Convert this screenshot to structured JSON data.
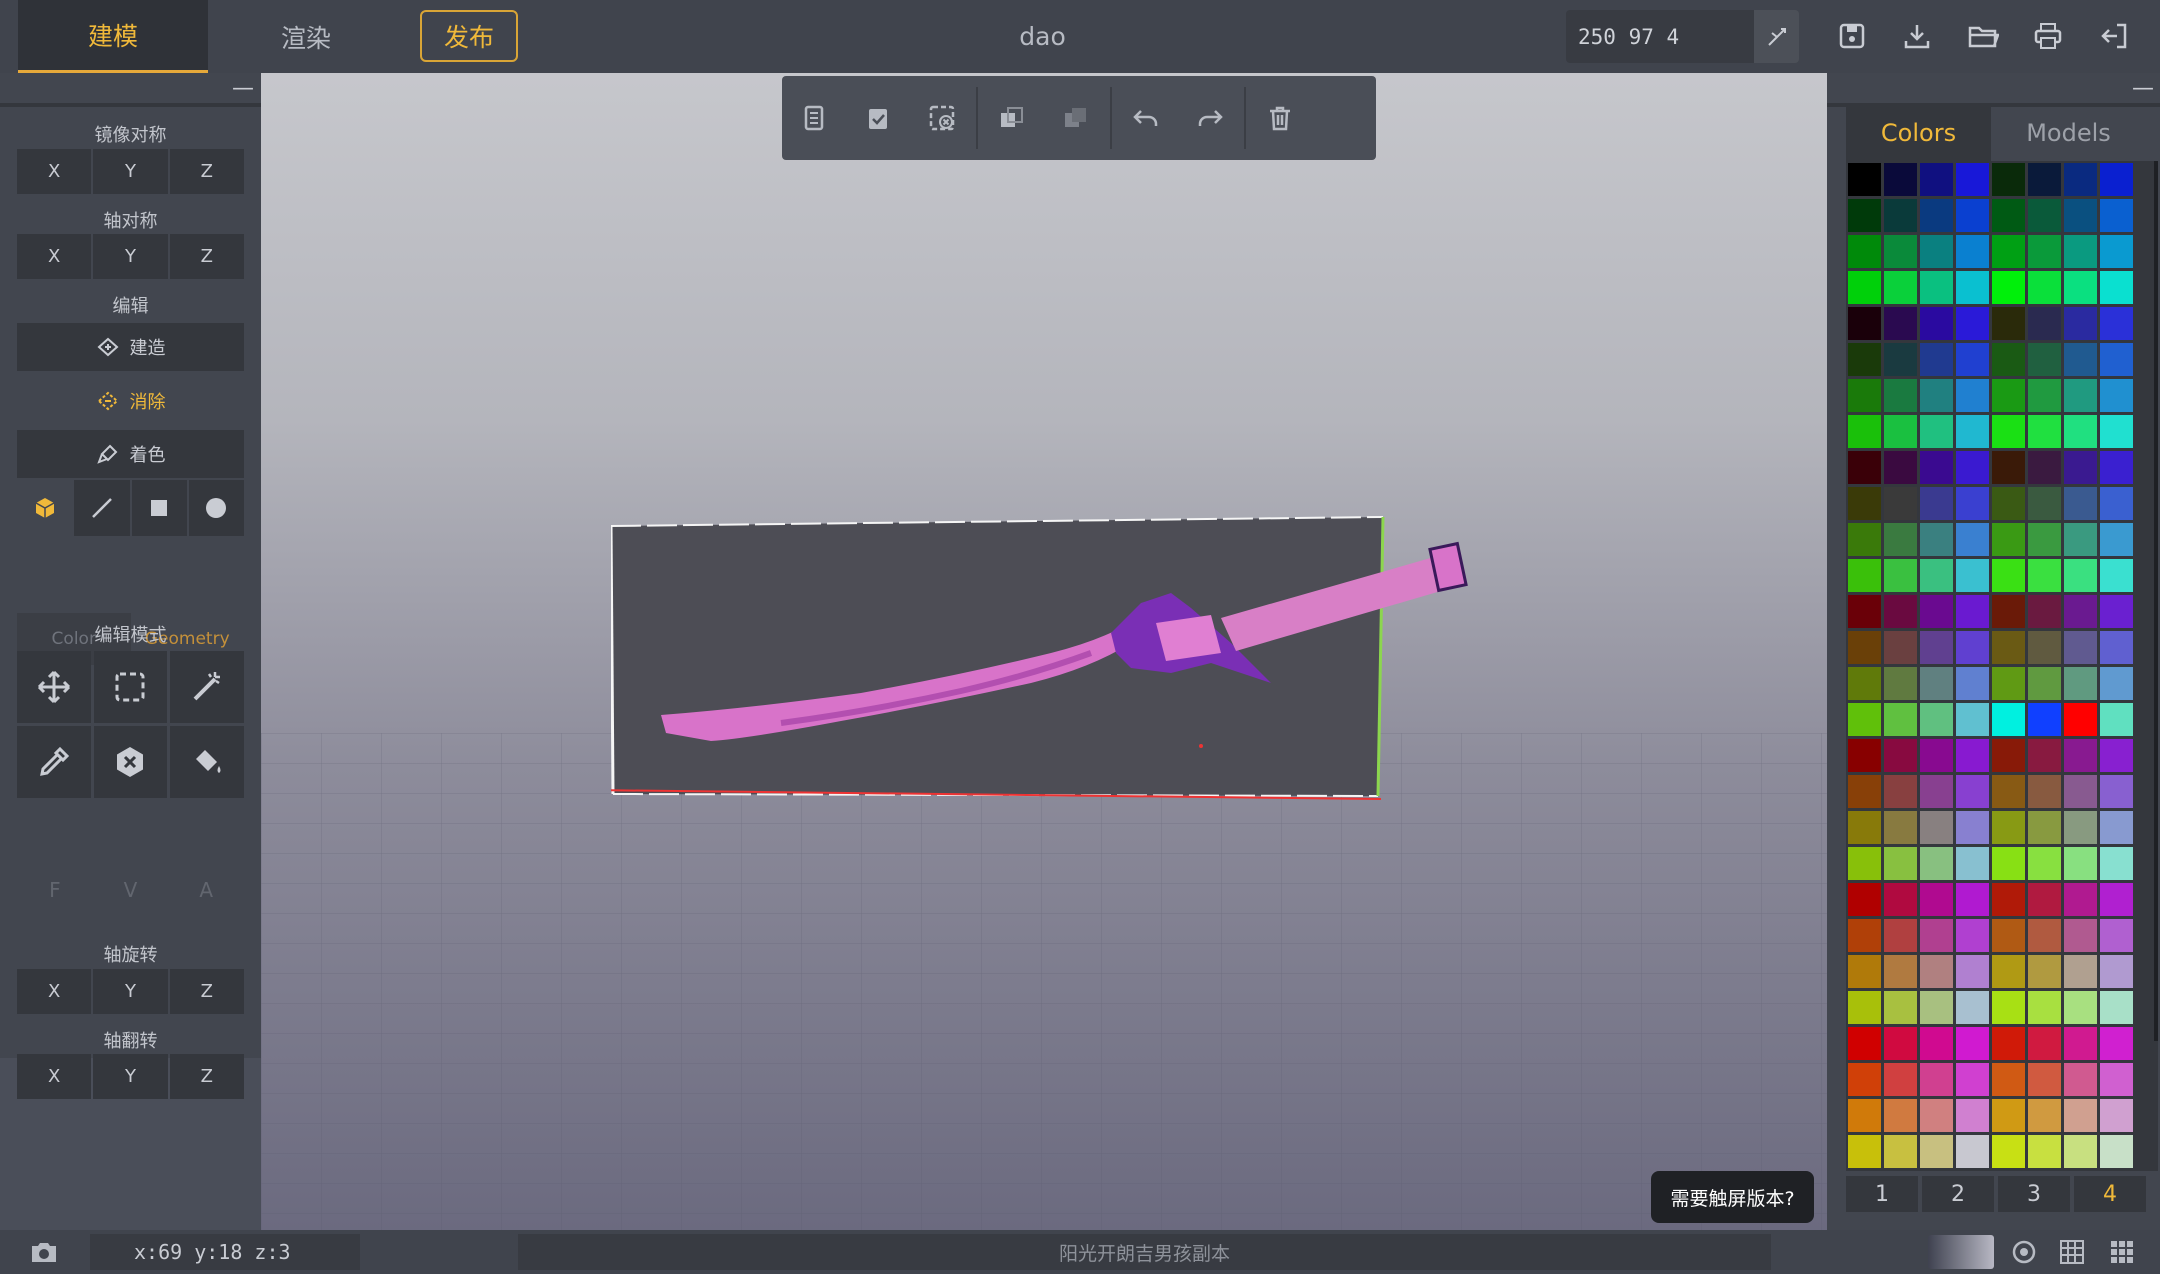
{
  "header": {
    "tabs": {
      "model": "建模",
      "render": "渲染",
      "publish": "发布"
    },
    "doc_title": "dao",
    "dimensions": "250 97 4",
    "icons": [
      "resize-icon",
      "save-icon",
      "download-icon",
      "open-folder-icon",
      "print-icon",
      "exit-icon"
    ]
  },
  "left_panel": {
    "collapse": "—",
    "mirror_label": "镜像对称",
    "axis_symmetry_label": "轴对称",
    "edit_label": "编辑",
    "build_label": "建造",
    "erase_label": "消除",
    "paint_label": "着色",
    "color_tab": "Color",
    "geometry_tab": "Geometry",
    "edit_mode_label": "编辑模式",
    "fva": [
      "F",
      "V",
      "A"
    ],
    "axis_rotate_label": "轴旋转",
    "axis_flip_label": "轴翻转",
    "axes": [
      "X",
      "Y",
      "Z"
    ]
  },
  "right_panel": {
    "collapse": "—",
    "tab_colors": "Colors",
    "tab_models": "Models",
    "pages": [
      "1",
      "2",
      "3",
      "4"
    ],
    "active_page": "4",
    "palette": [
      [
        "#000000",
        "#0a0a3a",
        "#101080",
        "#1818d8",
        "#0a2a0a",
        "#0a1a3a",
        "#0a2a80",
        "#0a20d0"
      ],
      [
        "#003a0a",
        "#0a3a3a",
        "#0a3a80",
        "#0a40d0",
        "#005a14",
        "#0a5a3a",
        "#0a5080",
        "#0a60d0"
      ],
      [
        "#008a0a",
        "#0a8a3a",
        "#0a8080",
        "#0a80d0",
        "#00a014",
        "#0a9a3a",
        "#0a9a80",
        "#0a9ad0"
      ],
      [
        "#00d00a",
        "#0ad03a",
        "#0ac080",
        "#0ac0d0",
        "#00f00a",
        "#0ae03a",
        "#0ae080",
        "#0ae0d0"
      ],
      [
        "#1a000a",
        "#2a0a50",
        "#2a0aa0",
        "#2a1ad8",
        "#2a2a0a",
        "#2a2a50",
        "#2a2aa0",
        "#2a30d8"
      ],
      [
        "#1a3a0a",
        "#1a3a40",
        "#203a90",
        "#2040d0",
        "#1a5a14",
        "#206040",
        "#205a90",
        "#2060d0"
      ],
      [
        "#1a7a0a",
        "#1a7a40",
        "#208080",
        "#2080d0",
        "#1a9a14",
        "#209a40",
        "#209a80",
        "#2090d0"
      ],
      [
        "#1ac00a",
        "#1ac040",
        "#20c080",
        "#20b8d0",
        "#1ae014",
        "#20e040",
        "#20e080",
        "#20e0d0"
      ],
      [
        "#3a0008",
        "#3a0a40",
        "#3a0a90",
        "#3a1ad0",
        "#3a1a08",
        "#3a1a40",
        "#3a1a90",
        "#3a20d0"
      ],
      [
        "#3a3a08",
        "#3a3a3a",
        "#3a3a90",
        "#3a40d0",
        "#3a5a14",
        "#3a5a40",
        "#3a5a90",
        "#3a60d0"
      ],
      [
        "#3a7a0a",
        "#3a7a40",
        "#3a8080",
        "#3a80d0",
        "#3a9a14",
        "#3a9a40",
        "#3a9a80",
        "#3a9ad0"
      ],
      [
        "#3ac00a",
        "#3ac040",
        "#3ac080",
        "#3ac0d0",
        "#3ae014",
        "#3ae040",
        "#3ae080",
        "#3ae0d0"
      ],
      [
        "#6a0008",
        "#6a0a40",
        "#6a0a90",
        "#6a1ad0",
        "#6a1a08",
        "#6a1a40",
        "#6a1a90",
        "#6a20d0"
      ],
      [
        "#6a4008",
        "#6a4040",
        "#604090",
        "#6040d0",
        "#6a5a14",
        "#605a40",
        "#605a90",
        "#6060d0"
      ],
      [
        "#607a0a",
        "#607a40",
        "#608080",
        "#6080d0",
        "#609a14",
        "#609a40",
        "#609a80",
        "#609ad0"
      ],
      [
        "#60c00a",
        "#60c040",
        "#60c080",
        "#60c0d0",
        "#00f0e0",
        "#1040ff",
        "#ff0000",
        "#60e0c0"
      ],
      [
        "#880000",
        "#880a40",
        "#880a90",
        "#881ad0",
        "#881a08",
        "#881a40",
        "#881a90",
        "#8820d0"
      ],
      [
        "#884008",
        "#884040",
        "#884090",
        "#8840d0",
        "#885a14",
        "#885a40",
        "#885a90",
        "#8860d0"
      ],
      [
        "#887a0a",
        "#887a40",
        "#888080",
        "#8880d0",
        "#889a14",
        "#889a40",
        "#889a80",
        "#889ad0"
      ],
      [
        "#88c00a",
        "#88c040",
        "#88c080",
        "#88c0d0",
        "#88e014",
        "#88e040",
        "#88e080",
        "#88e0d0"
      ],
      [
        "#b00000",
        "#b00a40",
        "#b00a90",
        "#b01ad0",
        "#b01a08",
        "#b01a40",
        "#b01a90",
        "#b020d0"
      ],
      [
        "#b04008",
        "#b04040",
        "#b04090",
        "#b040d0",
        "#b05a14",
        "#b05a40",
        "#b05a90",
        "#b060d0"
      ],
      [
        "#b07a0a",
        "#b07a40",
        "#b08080",
        "#b080d0",
        "#b09a14",
        "#b09a40",
        "#b0a090",
        "#b09ad0"
      ],
      [
        "#a8c00a",
        "#a8c040",
        "#a8c080",
        "#a8c0d0",
        "#a8e014",
        "#a8e040",
        "#a8e080",
        "#a8e0c8"
      ],
      [
        "#d00000",
        "#d00a40",
        "#d00a90",
        "#d01ad0",
        "#d01a08",
        "#d01a40",
        "#d01a90",
        "#d020d0"
      ],
      [
        "#d04008",
        "#d04040",
        "#d04090",
        "#d040d0",
        "#d05a14",
        "#d05a40",
        "#d05a90",
        "#d060d0"
      ],
      [
        "#d07a0a",
        "#d07a40",
        "#d08080",
        "#d080d0",
        "#d09a14",
        "#d09a40",
        "#d0a090",
        "#d0a0d0"
      ],
      [
        "#c8c00a",
        "#c8c040",
        "#c8c080",
        "#c8c8d0",
        "#c8e014",
        "#c8e040",
        "#c8e080",
        "#c8e0c8"
      ]
    ]
  },
  "touch_button": "需要触屏版本?",
  "status": {
    "coords": "x:69  y:18  z:3",
    "message": "阳光开朗吉男孩副本"
  },
  "colors": {
    "accent": "#f0b93a",
    "panel": "#42464f",
    "button": "#34373d"
  }
}
